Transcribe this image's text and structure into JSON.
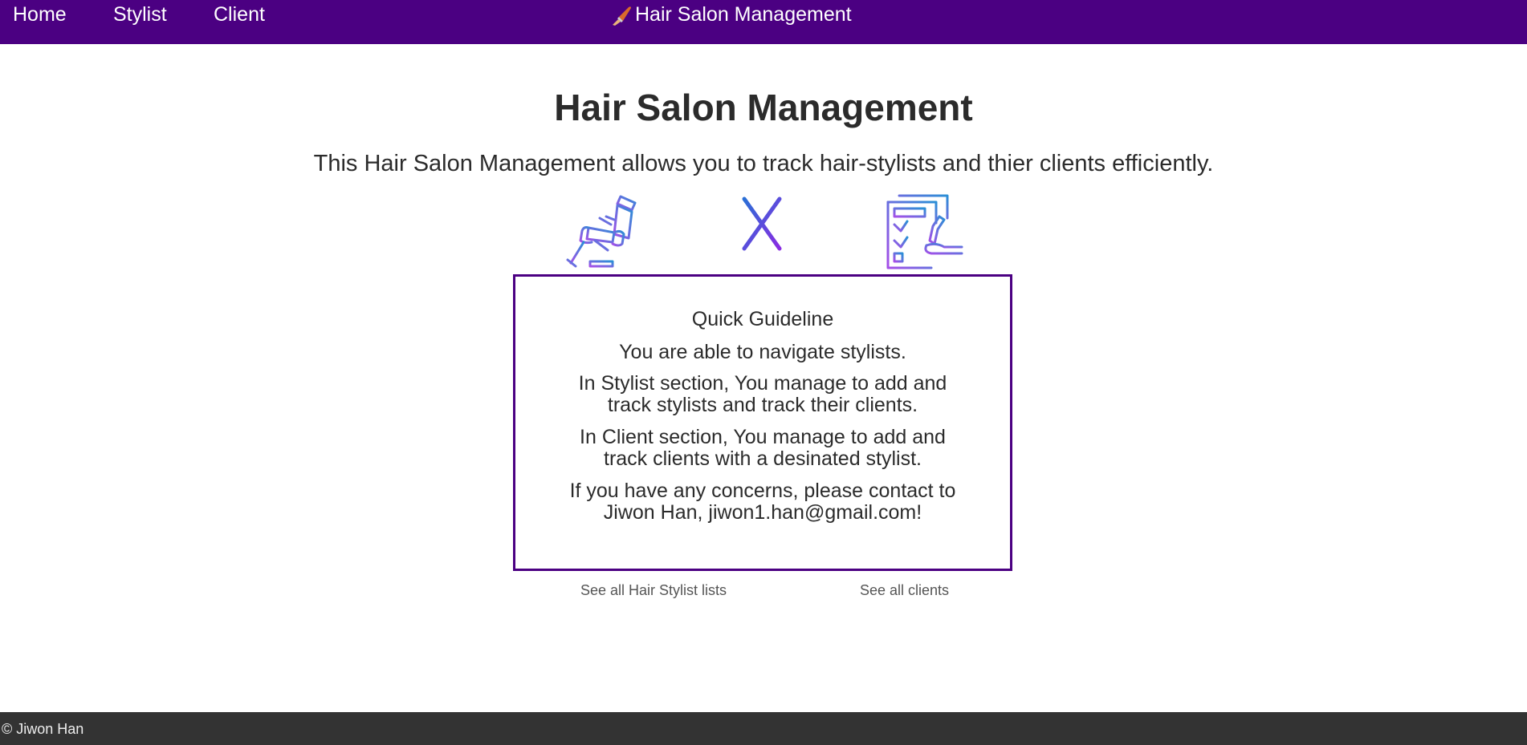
{
  "nav": {
    "home": "Home",
    "stylist": "Stylist",
    "client": "Client",
    "brand": "Hair Salon Management"
  },
  "main": {
    "title": "Hair Salon Management",
    "subtitle": "This Hair Salon Management allows you to track hair-stylists and thier clients efficiently.",
    "icons": [
      "salon-chair-icon",
      "x-icon",
      "checklist-icon"
    ]
  },
  "guide": {
    "title": "Quick Guideline",
    "line1": "You are able to navigate stylists.",
    "line2": "In Stylist section, You manage to add and track stylists and track their clients.",
    "line3": "In Client section, You manage to add and track clients with a desinated stylist.",
    "line4": "If you have any concerns, please contact to Jiwon Han, jiwon1.han@gmail.com!"
  },
  "links": {
    "stylists": "See all Hair Stylist lists",
    "clients": "See all clients"
  },
  "footer": {
    "text": "© Jiwon Han"
  },
  "colors": {
    "nav_bg": "#4b0082",
    "footer_bg": "#333333",
    "icon_gradient_start": "#2a8fd6",
    "icon_gradient_end": "#a64fe8"
  }
}
